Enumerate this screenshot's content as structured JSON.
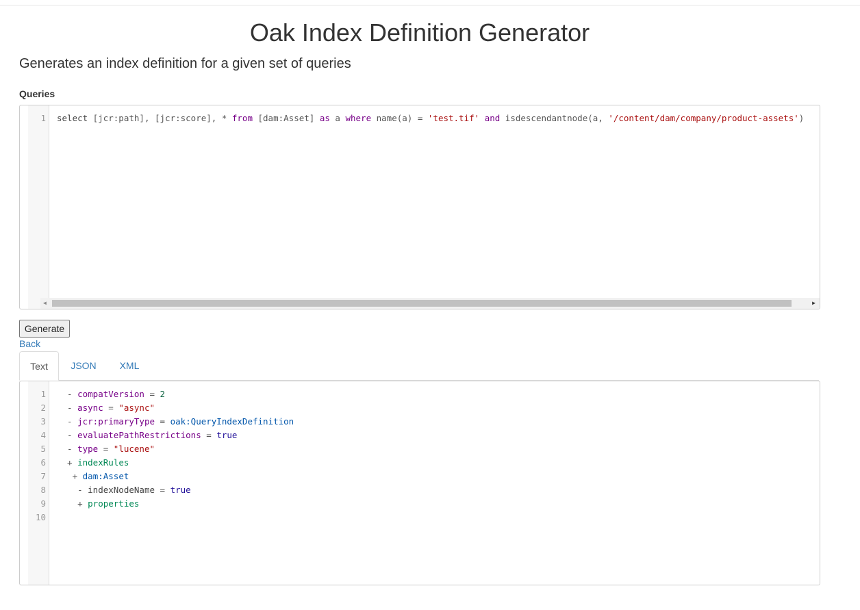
{
  "page": {
    "title": "Oak Index Definition Generator",
    "subtitle": "Generates an index definition for a given set of queries"
  },
  "queries": {
    "label": "Queries",
    "lines": [
      {
        "num": "1",
        "tokens": [
          {
            "t": "select",
            "c": "c-var"
          },
          {
            "t": " [jcr:path], [jcr:score], * ",
            "c": "c-op"
          },
          {
            "t": "from",
            "c": "c-kw"
          },
          {
            "t": " [dam:Asset] ",
            "c": "c-op"
          },
          {
            "t": "as",
            "c": "c-kw"
          },
          {
            "t": " a ",
            "c": "c-op"
          },
          {
            "t": "where",
            "c": "c-kw"
          },
          {
            "t": " name(a) = ",
            "c": "c-op"
          },
          {
            "t": "'test.tif'",
            "c": "c-str"
          },
          {
            "t": " ",
            "c": "c-op"
          },
          {
            "t": "and",
            "c": "c-kw"
          },
          {
            "t": " isdescendantnode(a, ",
            "c": "c-op"
          },
          {
            "t": "'/content/dam/company/product-assets'",
            "c": "c-str"
          },
          {
            "t": ")",
            "c": "c-op"
          }
        ]
      }
    ]
  },
  "actions": {
    "generate_label": "Generate",
    "back_label": "Back"
  },
  "tabs": [
    {
      "label": "Text",
      "active": true
    },
    {
      "label": "JSON",
      "active": false
    },
    {
      "label": "XML",
      "active": false
    }
  ],
  "output": {
    "lines": [
      {
        "num": "1",
        "tokens": [
          {
            "t": "  - ",
            "c": "c-op"
          },
          {
            "t": "compatVersion",
            "c": "c-key"
          },
          {
            "t": " = ",
            "c": "c-op"
          },
          {
            "t": "2",
            "c": "c-num"
          }
        ]
      },
      {
        "num": "2",
        "tokens": [
          {
            "t": "  - ",
            "c": "c-op"
          },
          {
            "t": "async",
            "c": "c-key"
          },
          {
            "t": " = ",
            "c": "c-op"
          },
          {
            "t": "\"async\"",
            "c": "c-str"
          }
        ]
      },
      {
        "num": "3",
        "tokens": [
          {
            "t": "  - ",
            "c": "c-op"
          },
          {
            "t": "jcr:primaryType",
            "c": "c-key"
          },
          {
            "t": " = ",
            "c": "c-op"
          },
          {
            "t": "oak:QueryIndexDefinition",
            "c": "c-def"
          }
        ]
      },
      {
        "num": "4",
        "tokens": [
          {
            "t": "  - ",
            "c": "c-op"
          },
          {
            "t": "evaluatePathRestrictions",
            "c": "c-key"
          },
          {
            "t": " = ",
            "c": "c-op"
          },
          {
            "t": "true",
            "c": "c-atom"
          }
        ]
      },
      {
        "num": "5",
        "tokens": [
          {
            "t": "  - ",
            "c": "c-op"
          },
          {
            "t": "type",
            "c": "c-key"
          },
          {
            "t": " = ",
            "c": "c-op"
          },
          {
            "t": "\"lucene\"",
            "c": "c-str"
          }
        ]
      },
      {
        "num": "6",
        "tokens": [
          {
            "t": "  + ",
            "c": "c-op"
          },
          {
            "t": "indexRules",
            "c": "c-node"
          }
        ]
      },
      {
        "num": "7",
        "tokens": [
          {
            "t": "   + ",
            "c": "c-op"
          },
          {
            "t": "dam:Asset",
            "c": "c-def"
          }
        ]
      },
      {
        "num": "8",
        "tokens": [
          {
            "t": "    - ",
            "c": "c-op"
          },
          {
            "t": "indexNodeName",
            "c": "c-var"
          },
          {
            "t": " = ",
            "c": "c-op"
          },
          {
            "t": "true",
            "c": "c-atom"
          }
        ]
      },
      {
        "num": "9",
        "tokens": [
          {
            "t": "    + ",
            "c": "c-op"
          },
          {
            "t": "properties",
            "c": "c-node"
          }
        ]
      },
      {
        "num": "10",
        "tokens": []
      }
    ]
  }
}
